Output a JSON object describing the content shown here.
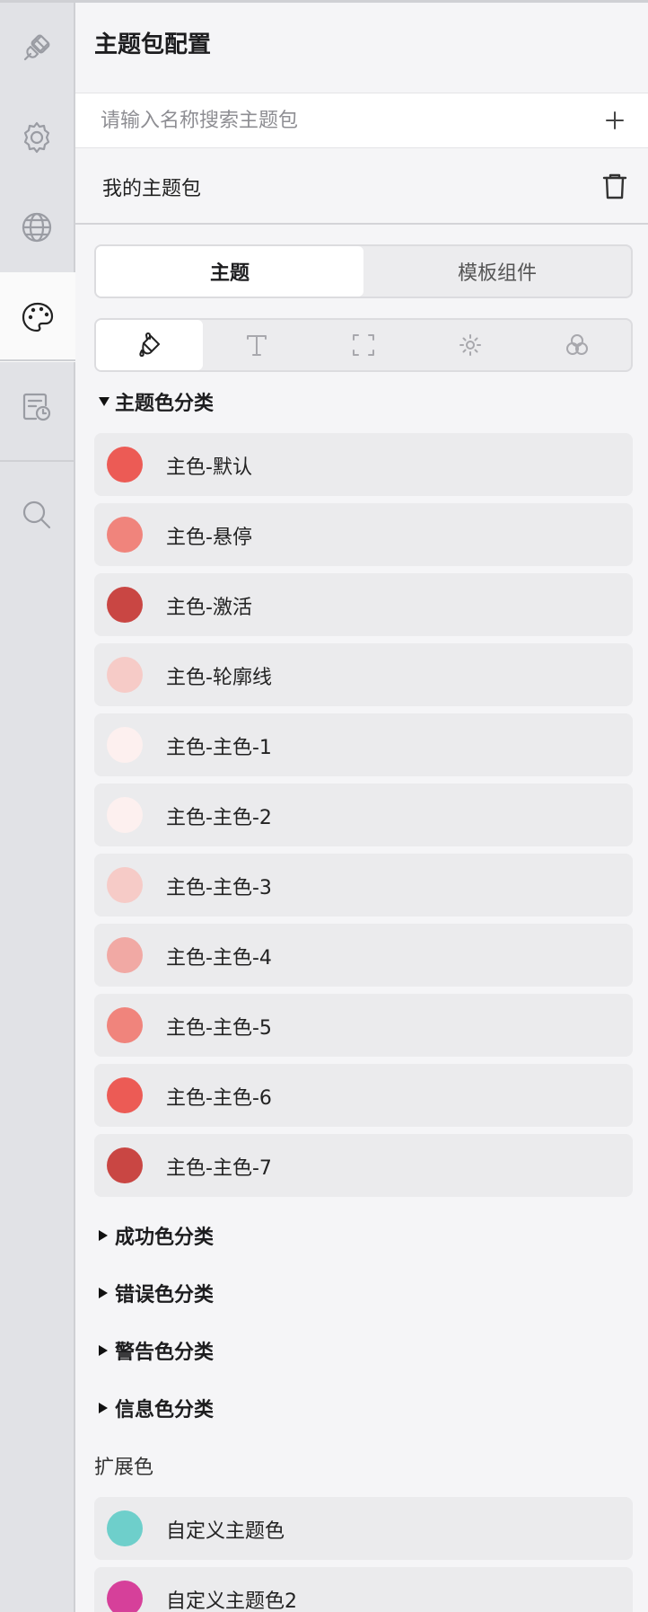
{
  "sidebar": {
    "items": [
      {
        "name": "plugin",
        "icon": "plug-icon",
        "active": false
      },
      {
        "name": "settings",
        "icon": "gear-icon",
        "active": false
      },
      {
        "name": "globe",
        "icon": "globe-icon",
        "active": false
      },
      {
        "name": "theme",
        "icon": "palette-icon",
        "active": true
      },
      {
        "name": "history",
        "icon": "calendar-clock-icon",
        "active": false
      },
      {
        "name": "search",
        "icon": "search-icon",
        "active": false
      }
    ]
  },
  "header": {
    "title": "主题包配置"
  },
  "search": {
    "placeholder": "请输入名称搜索主题包",
    "value": "",
    "add_icon": "plus-icon"
  },
  "pack": {
    "name": "我的主题包",
    "delete_icon": "trash-icon"
  },
  "segment": {
    "tabs": [
      {
        "label": "主题",
        "active": true
      },
      {
        "label": "模板组件",
        "active": false
      }
    ]
  },
  "icon_tabs": [
    {
      "icon": "paint-bucket-icon",
      "active": true
    },
    {
      "icon": "text-icon",
      "active": false
    },
    {
      "icon": "frame-icon",
      "active": false
    },
    {
      "icon": "sun-icon",
      "active": false
    },
    {
      "icon": "circles-icon",
      "active": false
    }
  ],
  "sections": {
    "primary": {
      "label": "主题色分类",
      "expanded": true
    },
    "success": {
      "label": "成功色分类",
      "expanded": false
    },
    "error": {
      "label": "错误色分类",
      "expanded": false
    },
    "warning": {
      "label": "警告色分类",
      "expanded": false
    },
    "info": {
      "label": "信息色分类",
      "expanded": false
    }
  },
  "primary_colors": [
    {
      "label": "主色-默认",
      "color": "#ec5b55"
    },
    {
      "label": "主色-悬停",
      "color": "#f0847c"
    },
    {
      "label": "主色-激活",
      "color": "#c94643"
    },
    {
      "label": "主色-轮廓线",
      "color": "#f6cbc7"
    },
    {
      "label": "主色-主色-1",
      "color": "#fdf0ef"
    },
    {
      "label": "主色-主色-2",
      "color": "#fdf0ef"
    },
    {
      "label": "主色-主色-3",
      "color": "#f6cbc7"
    },
    {
      "label": "主色-主色-4",
      "color": "#f1a9a4"
    },
    {
      "label": "主色-主色-5",
      "color": "#f0847c"
    },
    {
      "label": "主色-主色-6",
      "color": "#ec5b55"
    },
    {
      "label": "主色-主色-7",
      "color": "#c94643"
    }
  ],
  "extended": {
    "label": "扩展色",
    "items": [
      {
        "label": "自定义主题色",
        "color": "#6ecfcb"
      },
      {
        "label": "自定义主题色2",
        "color": "#d6409a"
      }
    ]
  }
}
